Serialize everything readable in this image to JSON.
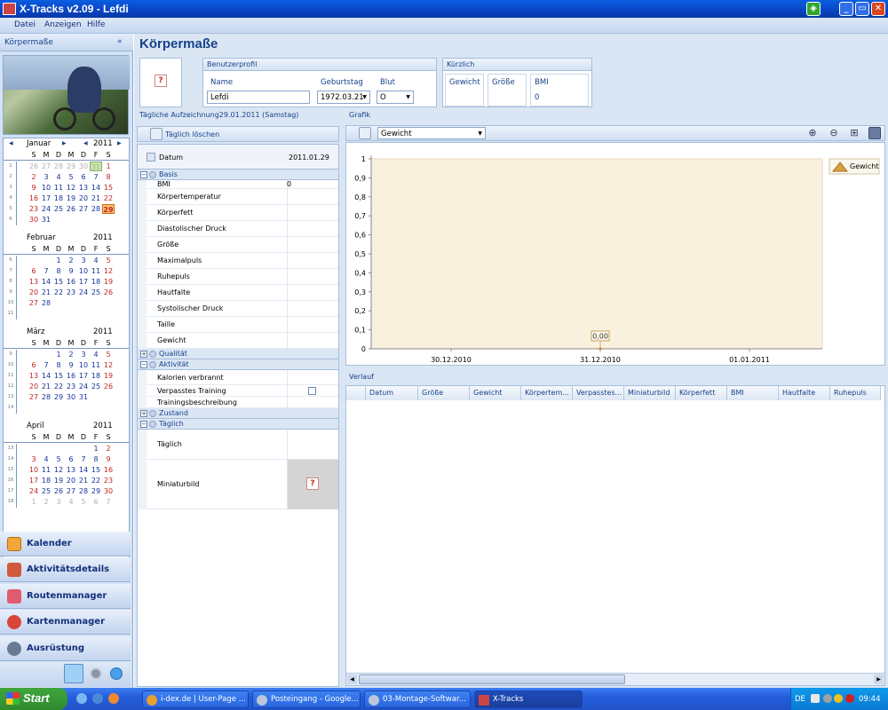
{
  "window": {
    "title": "X-Tracks v2.09 - Lefdi"
  },
  "menu": [
    "Datei",
    "Anzeigen",
    "Hilfe"
  ],
  "left": {
    "header": "Körpermaße",
    "collapse": "«",
    "months": [
      {
        "name": "Januar",
        "year": "2011",
        "nav": true
      },
      {
        "name": "Februar",
        "year": "2011"
      },
      {
        "name": "März",
        "year": "2011"
      },
      {
        "name": "April",
        "year": "2011"
      }
    ],
    "dow": [
      "S",
      "M",
      "D",
      "M",
      "D",
      "F",
      "S"
    ],
    "nav_buttons": [
      "Kalender",
      "Aktivitätsdetails",
      "Routenmanager",
      "Kartenmanager",
      "Ausrüstung"
    ]
  },
  "main": {
    "title": "Körpermaße",
    "profile": {
      "header": "Benutzerprofil",
      "name_label": "Name",
      "name_value": "Lefdi",
      "birthday_label": "Geburtstag",
      "birthday_value": "1972.03.21",
      "blood_label": "Blut",
      "blood_value": "O"
    },
    "recent": {
      "header": "Kürzlich",
      "weight_label": "Gewicht",
      "size_label": "Größe",
      "bmi_label": "BMI",
      "bmi_value": "0"
    },
    "daily": {
      "header": "Tägliche Aufzeichnung29.01.2011 (Samstag)",
      "delete_label": "Täglich löschen",
      "date_label": "Datum",
      "date_value": "2011.01.29",
      "cat_basis": "Basis",
      "basis_rows": [
        {
          "k": "BMI",
          "v": "0"
        },
        {
          "k": "Körpertemperatur",
          "v": ""
        },
        {
          "k": "Körperfett",
          "v": ""
        },
        {
          "k": "Diastolischer Druck",
          "v": ""
        },
        {
          "k": "Größe",
          "v": ""
        },
        {
          "k": "Maximalpuls",
          "v": ""
        },
        {
          "k": "Ruhepuls",
          "v": ""
        },
        {
          "k": "Hautfalte",
          "v": ""
        },
        {
          "k": "Systolischer Druck",
          "v": ""
        },
        {
          "k": "Taille",
          "v": ""
        },
        {
          "k": "Gewicht",
          "v": ""
        }
      ],
      "cat_quality": "Qualität",
      "cat_activity": "Aktivität",
      "activity_rows": [
        "Kalorien verbrannt",
        "Verpasstes Training",
        "Trainingsbeschreibung"
      ],
      "cat_state": "Zustand",
      "cat_daily": "Täglich",
      "daily_label": "Täglich",
      "thumb_label": "Miniaturbild"
    },
    "graph": {
      "header": "Grafik",
      "select_value": "Gewicht",
      "legend": "Gewicht",
      "point_label": "0,00"
    },
    "history": {
      "header": "Verlauf",
      "columns": [
        "Datum",
        "Größe",
        "Gewicht",
        "Körpertem...",
        "Verpasstes...",
        "Miniaturbild",
        "Körperfett",
        "BMI",
        "Hautfalte",
        "Ruhepuls"
      ]
    }
  },
  "taskbar": {
    "start": "Start",
    "tasks": [
      "i-dex.de | User-Page ...",
      "Posteingang - Google...",
      "03-Montage-Softwar...",
      "X-Tracks"
    ],
    "lang": "DE",
    "clock": "09:44"
  },
  "chart_data": {
    "type": "line",
    "x": [
      "30.12.2010",
      "31.12.2010",
      "01.01.2011"
    ],
    "series": [
      {
        "name": "Gewicht",
        "values": [
          null,
          0,
          null
        ]
      }
    ],
    "yticks": [
      "0",
      "0,1",
      "0,2",
      "0,3",
      "0,4",
      "0,5",
      "0,6",
      "0,7",
      "0,8",
      "0,9",
      "1"
    ],
    "ylim": [
      0,
      1
    ],
    "legend": "top-right",
    "grid": false
  }
}
